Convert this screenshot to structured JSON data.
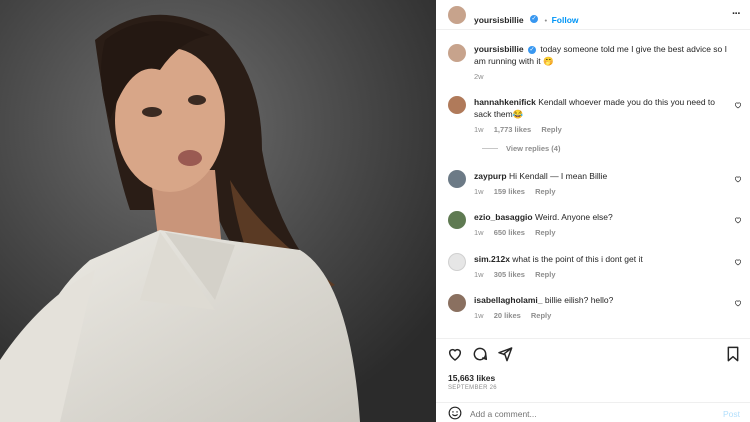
{
  "post": {
    "author": "yoursisbillie",
    "follow_label": "Follow",
    "more_label": "···",
    "caption": "today someone told me I give the best advice so I am running with it 🤭",
    "age": "2w"
  },
  "comments": [
    {
      "user": "hannahkenifick",
      "text": "Kendall whoever made you do this you need to sack them😂",
      "time": "1w",
      "likes": "1,773 likes",
      "reply": "Reply",
      "view_replies": "View replies (4)"
    },
    {
      "user": "zaypurp",
      "text": "Hi Kendall — I mean Billie",
      "time": "1w",
      "likes": "159 likes",
      "reply": "Reply"
    },
    {
      "user": "ezio_basaggio",
      "text": "Weird. Anyone else?",
      "time": "1w",
      "likes": "650 likes",
      "reply": "Reply"
    },
    {
      "user": "sim.212x",
      "text": "what is the point of this i dont get it",
      "time": "1w",
      "likes": "305 likes",
      "reply": "Reply"
    },
    {
      "user": "isabellagholami_",
      "text": "billie eilish? hello?",
      "time": "1w",
      "likes": "20 likes",
      "reply": "Reply"
    }
  ],
  "footer": {
    "likes": "15,663 likes",
    "date": "SEPTEMBER 26",
    "comment_placeholder": "Add a comment...",
    "post_label": "Post"
  },
  "icons": [
    "heart-icon",
    "comment-icon",
    "share-icon",
    "bookmark-icon",
    "more-icon",
    "verified-icon"
  ],
  "colors": {
    "accent": "#0095f6",
    "verified": "#3897f0",
    "muted": "#8e8e8e"
  }
}
